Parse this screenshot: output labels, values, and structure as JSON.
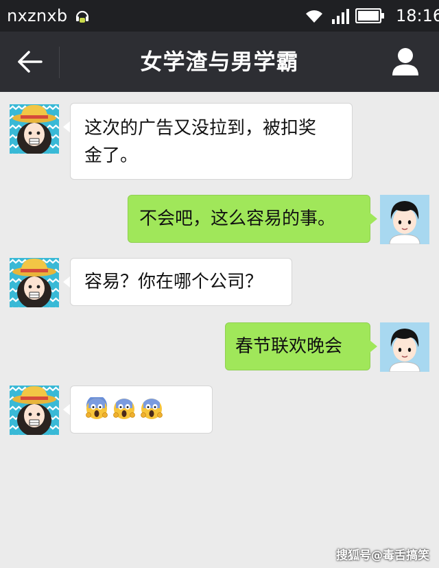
{
  "status_bar": {
    "carrier": "nxznxb",
    "time": "18:16"
  },
  "header": {
    "title": "女学渣与男学霸",
    "back_icon": "arrow-left-icon",
    "profile_icon": "person-icon"
  },
  "messages": [
    {
      "side": "left",
      "text_line1": "这次的广告又没拉到，被扣奖",
      "text_line2": "金了。"
    },
    {
      "side": "right",
      "text": "不会吧，这么容易的事。"
    },
    {
      "side": "left",
      "text": "容易？你在哪个公司？"
    },
    {
      "side": "right",
      "text": "春节联欢晚会"
    },
    {
      "side": "left",
      "emoji": [
        "scream-emoji",
        "scream-emoji",
        "scream-emoji"
      ]
    }
  ],
  "watermark": "搜狐号@毒舌搞笑",
  "colors": {
    "status_bar": "#1f2023",
    "title_bar": "#2d2e33",
    "background": "#ebebeb",
    "sent_bubble": "#a0e75a",
    "received_bubble": "#ffffff"
  }
}
